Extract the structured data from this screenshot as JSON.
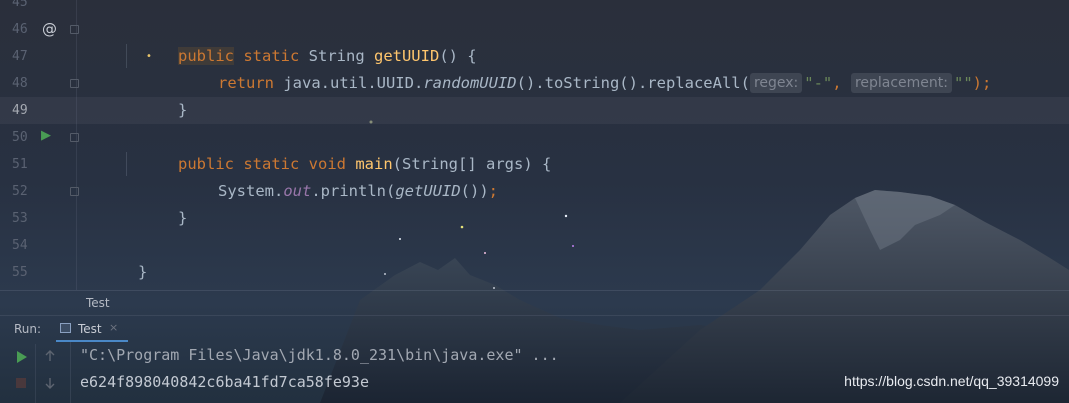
{
  "editor": {
    "line_numbers": [
      "45",
      "46",
      "47",
      "48",
      "49",
      "50",
      "51",
      "52",
      "53",
      "54",
      "55"
    ],
    "current_line": "49",
    "lines": {
      "l46": {
        "public": "public",
        "static": " static ",
        "type": "String ",
        "name": "getUUID",
        "rest": "() {"
      },
      "l47": {
        "return": "return ",
        "pkg": "java.util.UUID.",
        "method": "randomUUID",
        "chain": "().toString().replaceAll(",
        "hint_regex": "regex:",
        "arg1": "\"-\"",
        "comma": ", ",
        "hint_replacement": "replacement:",
        "arg2": "\"\"",
        "end": ");"
      },
      "l48": {
        "brace": "}"
      },
      "l50": {
        "public": "public",
        "rest_kw": " static void ",
        "name": "main",
        "params_open": "(",
        "params_type": "String[] args",
        "params_close": ") {"
      },
      "l51": {
        "system": "System.",
        "out": "out",
        "println": ".println(",
        "call": "getUUID",
        "end_paren": "())",
        "semi": ";"
      },
      "l52": {
        "brace": "}"
      },
      "l54": {
        "brace": "}"
      }
    },
    "gutter_icons": {
      "override_icon": "@",
      "run_icon": "▶"
    }
  },
  "breadcrumb": "Test",
  "run_panel": {
    "label": "Run:",
    "tab_label": "Test",
    "tab_close": "×",
    "console": [
      "\"C:\\Program Files\\Java\\jdk1.8.0_231\\bin\\java.exe\" ...",
      "e624f898040842c6ba41fd7ca58fe93e"
    ]
  },
  "watermark": "https://blog.csdn.net/qq_39314099",
  "colors": {
    "keyword": "#cc7832",
    "function": "#ffc66d",
    "field": "#9876aa",
    "string": "#6a8759",
    "text": "#a9b7c6",
    "run_green": "#499c54",
    "selected_tab_underline": "#4a88c7"
  },
  "icons": [
    "override-icon",
    "run-gutter-icon",
    "rerun-icon",
    "stop-icon",
    "console-tab-icon",
    "close-icon",
    "scroll-down-icon"
  ]
}
